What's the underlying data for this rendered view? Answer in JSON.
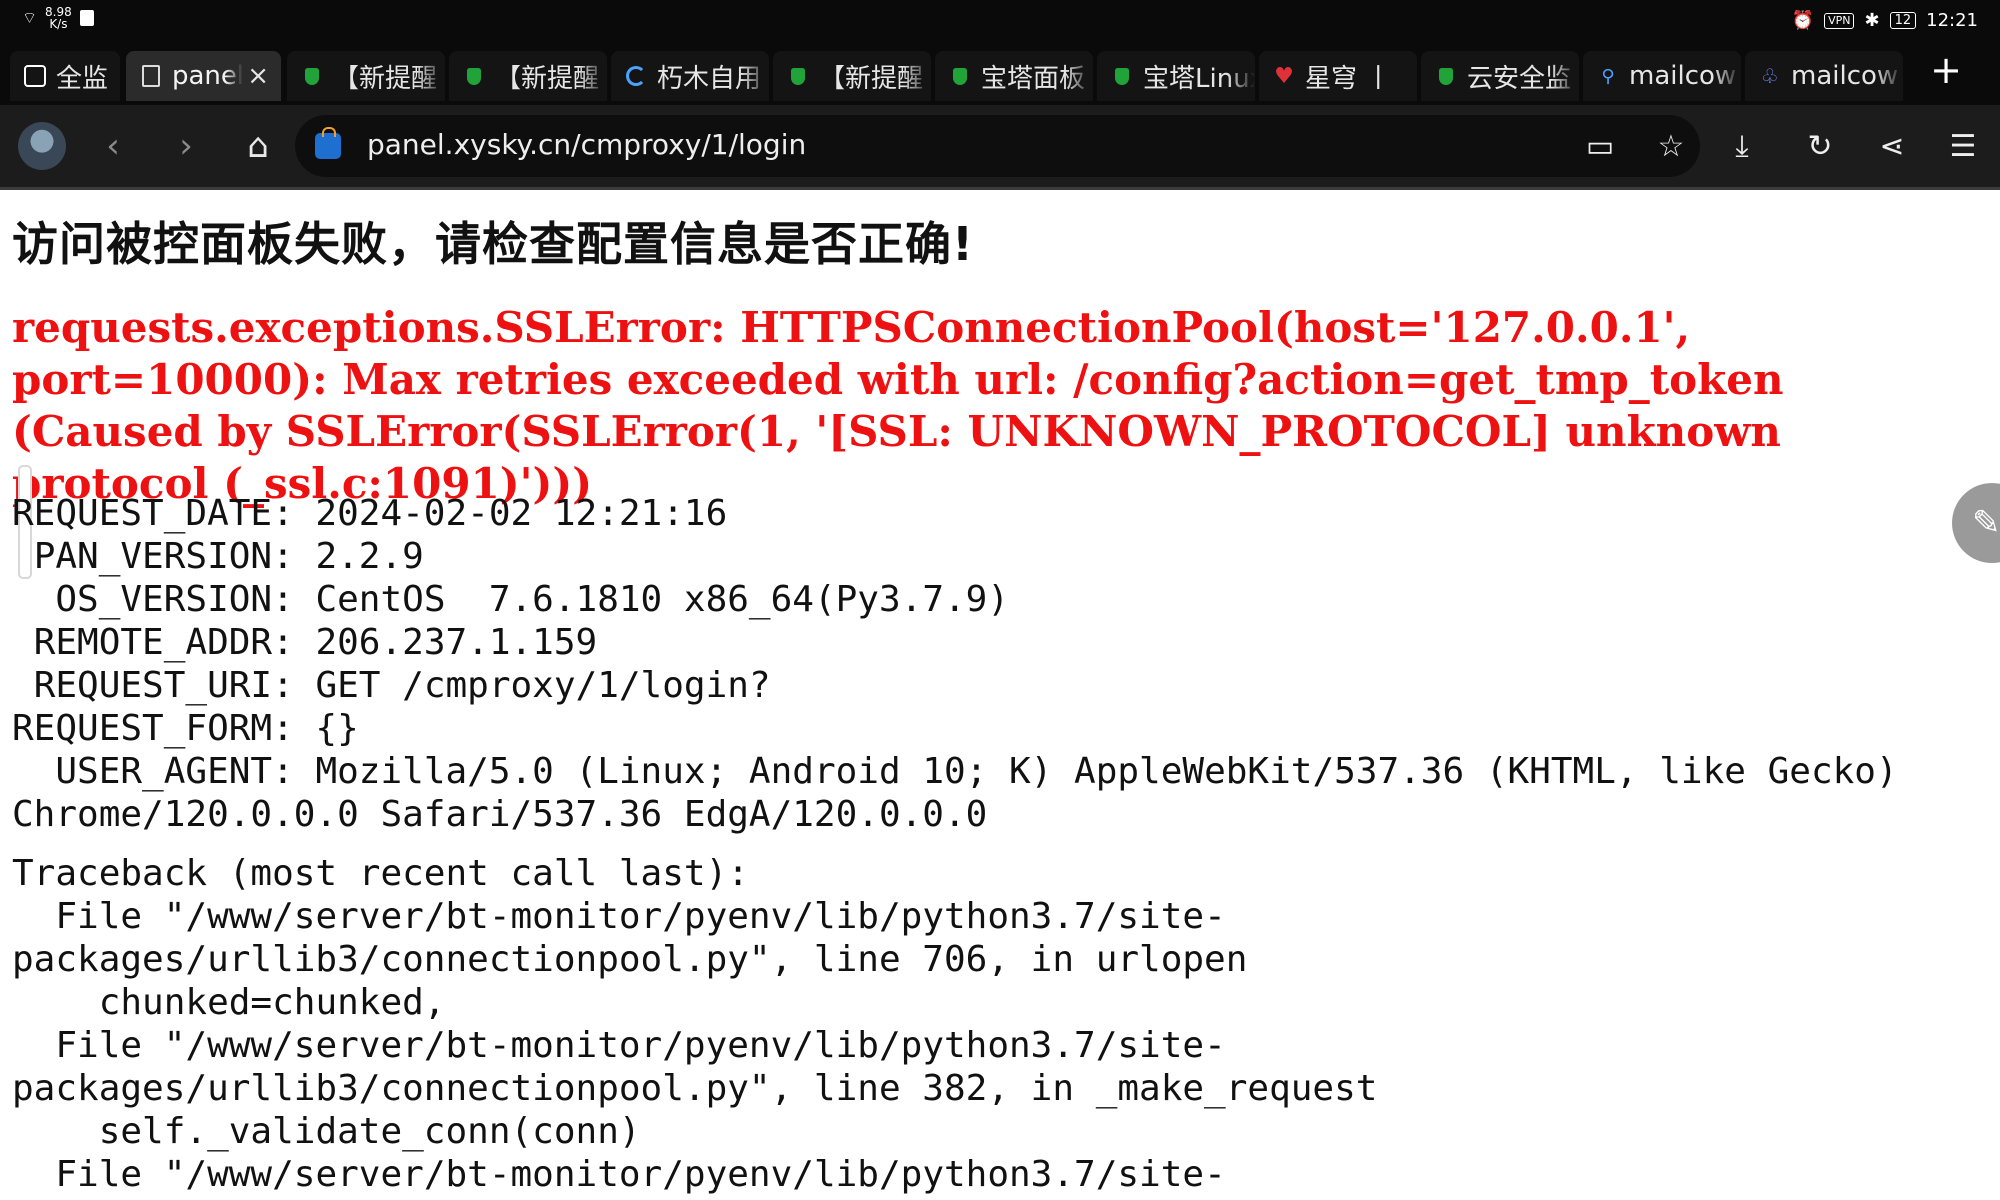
{
  "statusbar": {
    "speed_value": "8.98",
    "speed_unit": "K/s",
    "vpn_label": "VPN",
    "battery": "12",
    "time": "12:21"
  },
  "tabs": [
    {
      "label": "全监",
      "icon": "tab-overview-icon"
    },
    {
      "label": "panel",
      "icon": "page-icon"
    },
    {
      "label": "【新提醒",
      "icon": "shield-icon"
    },
    {
      "label": "【新提醒",
      "icon": "shield-icon"
    },
    {
      "label": "朽木自用",
      "icon": "loading-icon"
    },
    {
      "label": "【新提醒",
      "icon": "shield-icon"
    },
    {
      "label": "宝塔面板",
      "icon": "shield-icon"
    },
    {
      "label": "宝塔Linux",
      "icon": "shield-icon"
    },
    {
      "label": "星穹 丨",
      "icon": "heart-icon"
    },
    {
      "label": "云安全监",
      "icon": "shield-icon"
    },
    {
      "label": "mailcow",
      "icon": "search-icon"
    },
    {
      "label": "mailcow",
      "icon": "mailcow-icon"
    }
  ],
  "new_tab_label": "+",
  "toolbar": {
    "url": "panel.xysky.cn/cmproxy/1/login"
  },
  "page": {
    "heading": "访问被控面板失败，请检查配置信息是否正确!",
    "error": "requests.exceptions.SSLError: HTTPSConnectionPool(host='127.0.0.1', port=10000): Max retries exceeded with url: /config?action=get_tmp_token (Caused by SSLError(SSLError(1, '[SSL: UNKNOWN_PROTOCOL] unknown protocol (_ssl.c:1091)')))",
    "info": {
      "request_date": "REQUEST_DATE: 2024-02-02 12:21:16",
      "pan_version": " PAN_VERSION: 2.2.9",
      "os_version": "  OS_VERSION: CentOS  7.6.1810 x86_64(Py3.7.9)",
      "remote_addr": " REMOTE_ADDR: 206.237.1.159",
      "request_uri": " REQUEST_URI: GET /cmproxy/1/login?",
      "request_form": "REQUEST_FORM: {}",
      "user_agent": "  USER_AGENT: Mozilla/5.0 (Linux; Android 10; K) AppleWebKit/537.36 (KHTML, like Gecko) Chrome/120.0.0.0 Safari/537.36 EdgA/120.0.0.0"
    },
    "traceback": {
      "header": "Traceback (most recent call last):",
      "lines": [
        "  File \"/www/server/bt-monitor/pyenv/lib/python3.7/site-packages/urllib3/connectionpool.py\", line 706, in urlopen",
        "    chunked=chunked,",
        "  File \"/www/server/bt-monitor/pyenv/lib/python3.7/site-packages/urllib3/connectionpool.py\", line 382, in _make_request",
        "    self._validate_conn(conn)",
        "  File \"/www/server/bt-monitor/pyenv/lib/python3.7/site-"
      ]
    }
  }
}
